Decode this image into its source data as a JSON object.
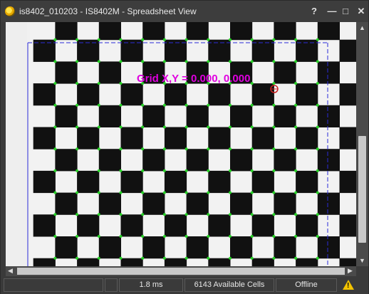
{
  "window": {
    "title": "is8402_010203 - IS8402M - Spreadsheet View",
    "controls": {
      "help": "?",
      "minimize": "—",
      "maximize": "□",
      "close": "✕"
    }
  },
  "overlay": {
    "grid_readout": "Grid X,Y = 0.000, 0.000"
  },
  "status": {
    "blank1": "",
    "blank2": "",
    "time": "1.8 ms",
    "cells": "6143 Available Cells",
    "mode": "Offline"
  },
  "colors": {
    "overlay_text": "#e000e0",
    "grid_points": "#22dd22",
    "roi_line": "#2a2ad8",
    "cursor": "#cc2020"
  },
  "icons": [
    "app-icon",
    "help-icon",
    "minimize-icon",
    "maximize-icon",
    "close-icon",
    "warning-icon",
    "scroll-up-icon",
    "scroll-down-icon",
    "scroll-left-icon",
    "scroll-right-icon"
  ]
}
